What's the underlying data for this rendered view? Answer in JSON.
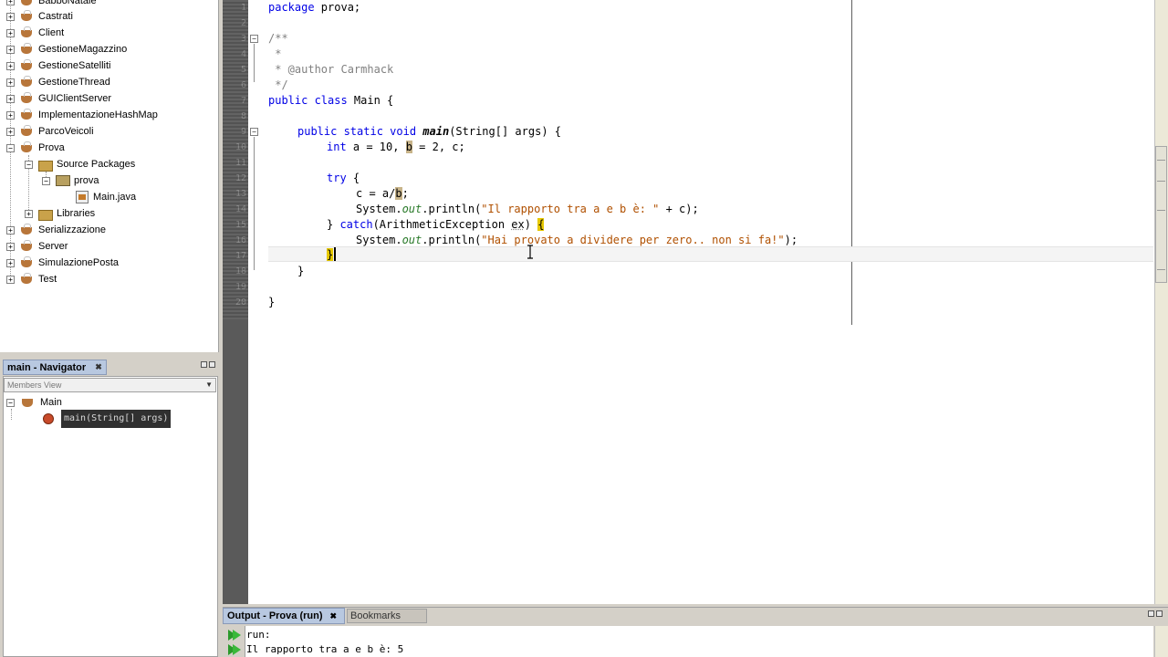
{
  "projects": {
    "items": [
      {
        "label": "BabboNatale",
        "type": "project",
        "expander": "+"
      },
      {
        "label": "Castrati",
        "type": "project",
        "expander": "+"
      },
      {
        "label": "Client",
        "type": "project",
        "expander": "+"
      },
      {
        "label": "GestioneMagazzino",
        "type": "project",
        "expander": "+"
      },
      {
        "label": "GestioneSatelliti",
        "type": "project",
        "expander": "+"
      },
      {
        "label": "GestioneThread",
        "type": "project",
        "expander": "+"
      },
      {
        "label": "GUIClientServer",
        "type": "project",
        "expander": "+"
      },
      {
        "label": "ImplementazioneHashMap",
        "type": "project",
        "expander": "+"
      },
      {
        "label": "ParcoVeicoli",
        "type": "project",
        "expander": "+"
      },
      {
        "label": "Prova",
        "type": "project",
        "expander": "−"
      },
      {
        "label": "Source Packages",
        "type": "folder",
        "expander": "−"
      },
      {
        "label": "prova",
        "type": "package",
        "expander": "−"
      },
      {
        "label": "Main.java",
        "type": "file",
        "expander": ""
      },
      {
        "label": "Libraries",
        "type": "folder",
        "expander": "+"
      },
      {
        "label": "Serializzazione",
        "type": "project",
        "expander": "+"
      },
      {
        "label": "Server",
        "type": "project",
        "expander": "+"
      },
      {
        "label": "SimulazionePosta",
        "type": "project",
        "expander": "+"
      },
      {
        "label": "Test",
        "type": "project",
        "expander": "+"
      }
    ]
  },
  "navigator": {
    "tab_label": "main - Navigator",
    "tab_close": "✖",
    "filter_label": "Members View",
    "class_label": "Main",
    "method_label": "main(String[] args)"
  },
  "editor": {
    "file": "Main.java",
    "line_numbers": [
      "1",
      "2",
      "3",
      "4",
      "5",
      "6",
      "7",
      "8",
      "9",
      "10",
      "11",
      "12",
      "13",
      "14",
      "15",
      "16",
      "17",
      "18",
      "19",
      "20"
    ],
    "lines": {
      "l1_kw": "package",
      "l1_rest": " prova;",
      "l3": "/**",
      "l4": " *",
      "l5": " * @author Carmhack",
      "l6": " */",
      "l7_kw": "public class",
      "l7_rest": " Main {",
      "l9_kw": "public static void",
      "l9_method": "main",
      "l9_rest": "(String[] args) {",
      "l10_kw": "int",
      "l10_a": " a = 10, ",
      "l10_b": "b",
      "l10_rest": " = 2, c;",
      "l12_kw": "try",
      "l12_rest": " {",
      "l13_a": "c = a/",
      "l13_b": "b",
      "l13_rest": ";",
      "l14_a": "System.",
      "l14_out": "out",
      "l14_b": ".println(",
      "l14_str": "\"Il rapporto tra a e b è: \"",
      "l14_rest": " + c);",
      "l15_a": "} ",
      "l15_kw": "catch",
      "l15_b": "(ArithmeticException ",
      "l15_ex": "ex",
      "l15_c": ") ",
      "l15_brace": "{",
      "l16_a": "System.",
      "l16_out": "out",
      "l16_b": ".println(",
      "l16_str": "\"Hai provato a dividere per zero.. non si fa!\"",
      "l16_rest": ");",
      "l17_brace": "}",
      "l18": "}",
      "l20": "}"
    }
  },
  "output": {
    "tab_label": "Output - Prova (run)",
    "tab_close": "✖",
    "bookmarks_label": "Bookmarks",
    "lines": [
      "run:",
      "Il rapporto tra a e b è: 5"
    ]
  },
  "colors": {
    "keyword": "#0000e6",
    "comment": "#808080",
    "string": "#b05000",
    "highlight": "#e6c800",
    "tab_active": "#b8c8e0"
  }
}
